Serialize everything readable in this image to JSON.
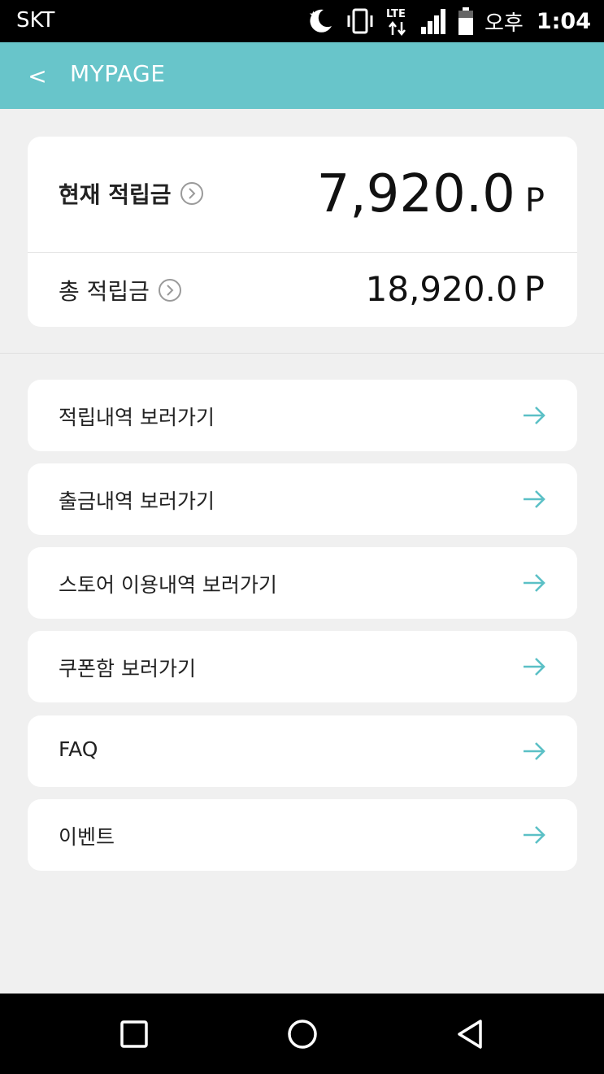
{
  "status_bar": {
    "carrier": "SKT",
    "ampm": "오후",
    "time": "1:04",
    "network": "LTE",
    "icons": [
      "night-mode-icon",
      "vibrate-icon",
      "lte-data-icon",
      "signal-icon",
      "battery-icon"
    ]
  },
  "app_bar": {
    "back_label": "<",
    "title": "MYPAGE"
  },
  "points": {
    "current": {
      "label": "현재 적립금",
      "value": "7,920.0",
      "unit": "P"
    },
    "total": {
      "label": "총 적립금",
      "value": "18,920.0",
      "unit": "P"
    }
  },
  "menu": {
    "items": [
      {
        "label": "적립내역 보러가기"
      },
      {
        "label": "출금내역 보러가기"
      },
      {
        "label": "스토어 이용내역 보러가기"
      },
      {
        "label": "쿠폰함 보러가기"
      },
      {
        "label": "FAQ"
      },
      {
        "label": "이벤트"
      }
    ]
  },
  "colors": {
    "accent": "#68c5ca",
    "arrow": "#5bc0c6",
    "background": "#f0f0f0"
  }
}
